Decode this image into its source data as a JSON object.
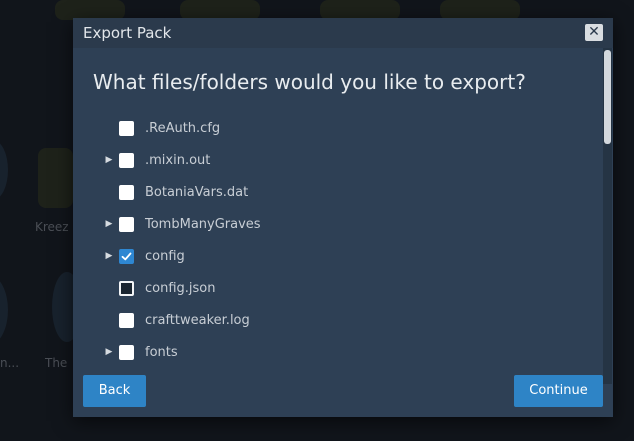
{
  "background": {
    "labels": [
      "Kreez",
      "The",
      "n..."
    ]
  },
  "dialog": {
    "title": "Export Pack",
    "close_icon": "close-icon",
    "heading": "What files/folders would you like to export?",
    "items": [
      {
        "label": ".ReAuth.cfg",
        "expandable": false,
        "checked": false
      },
      {
        "label": ".mixin.out",
        "expandable": true,
        "checked": false
      },
      {
        "label": "BotaniaVars.dat",
        "expandable": false,
        "checked": false
      },
      {
        "label": "TombManyGraves",
        "expandable": true,
        "checked": false
      },
      {
        "label": "config",
        "expandable": true,
        "checked": true
      },
      {
        "label": "config.json",
        "expandable": false,
        "checked": false
      },
      {
        "label": "crafttweaker.log",
        "expandable": false,
        "checked": false
      },
      {
        "label": "fonts",
        "expandable": true,
        "checked": false
      }
    ],
    "back_label": "Back",
    "continue_label": "Continue"
  },
  "colors": {
    "dialog_bg": "#2e4055",
    "accent": "#2e84c6"
  }
}
